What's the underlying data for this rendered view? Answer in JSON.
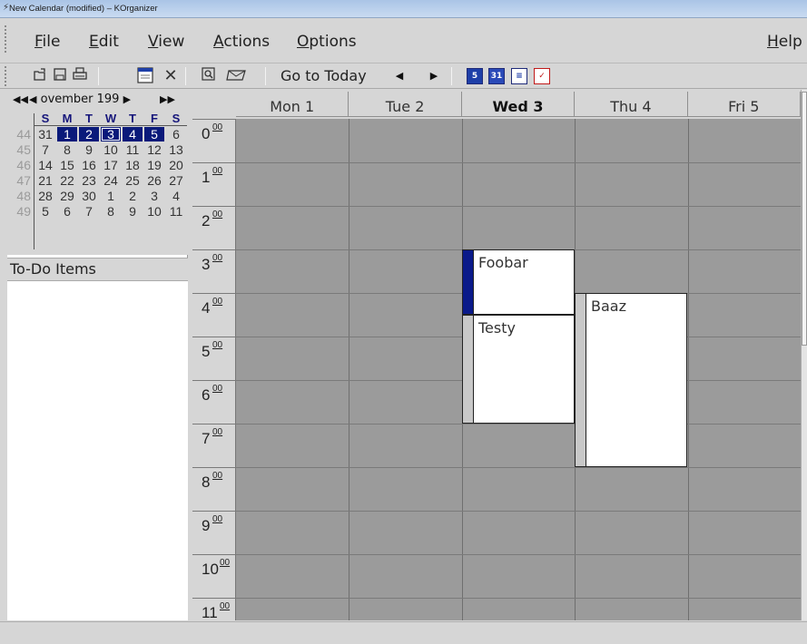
{
  "window": {
    "title": "New Calendar (modified) – KOrganizer"
  },
  "menubar": {
    "items": [
      {
        "mnemonic": "F",
        "rest": "ile"
      },
      {
        "mnemonic": "E",
        "rest": "dit"
      },
      {
        "mnemonic": "V",
        "rest": "iew"
      },
      {
        "mnemonic": "A",
        "rest": "ctions"
      },
      {
        "mnemonic": "O",
        "rest": "ptions"
      },
      {
        "mnemonic": "H",
        "rest": "elp"
      }
    ]
  },
  "toolbar": {
    "icons": [
      "open-icon",
      "save-icon",
      "print-icon",
      "new-event-icon",
      "delete-icon",
      "find-icon",
      "mail-icon"
    ],
    "go_to_today": "Go to Today",
    "prev_glyph": "◀",
    "next_glyph": "▶",
    "view_buttons": [
      {
        "icon": "work-week-view-icon",
        "label": "5"
      },
      {
        "icon": "month-view-icon",
        "label": "31"
      },
      {
        "icon": "list-view-icon",
        "label": "≡"
      },
      {
        "icon": "todo-view-icon",
        "label": "✓"
      }
    ]
  },
  "mini_calendar": {
    "month_label": "ovember 199",
    "prev_year": "◀◀",
    "prev_month": "◀",
    "next_month": "▶",
    "next_year": "▶▶",
    "weekday_headers": [
      "S",
      "M",
      "T",
      "W",
      "T",
      "F",
      "S"
    ],
    "weeks": [
      {
        "week": "44",
        "days": [
          "31",
          "1",
          "2",
          "3",
          "4",
          "5",
          "6"
        ]
      },
      {
        "week": "45",
        "days": [
          "7",
          "8",
          "9",
          "10",
          "11",
          "12",
          "13"
        ]
      },
      {
        "week": "46",
        "days": [
          "14",
          "15",
          "16",
          "17",
          "18",
          "19",
          "20"
        ]
      },
      {
        "week": "47",
        "days": [
          "21",
          "22",
          "23",
          "24",
          "25",
          "26",
          "27"
        ]
      },
      {
        "week": "48",
        "days": [
          "28",
          "29",
          "30",
          "1",
          "2",
          "3",
          "4"
        ]
      },
      {
        "week": "49",
        "days": [
          "5",
          "6",
          "7",
          "8",
          "9",
          "10",
          "11"
        ]
      }
    ],
    "selected_days": [
      "1",
      "2",
      "4",
      "5"
    ],
    "today": "3"
  },
  "todo": {
    "header": "To-Do Items"
  },
  "agenda": {
    "days": [
      {
        "label": "Mon 1",
        "today": false
      },
      {
        "label": "Tue 2",
        "today": false
      },
      {
        "label": "Wed 3",
        "today": true
      },
      {
        "label": "Thu 4",
        "today": false
      },
      {
        "label": "Fri 5",
        "today": false
      }
    ],
    "hours": [
      "0",
      "1",
      "2",
      "3",
      "4",
      "5",
      "6",
      "7",
      "8",
      "9",
      "10",
      "11"
    ],
    "minutes_label": "00",
    "events": [
      {
        "title": "Foobar",
        "day": 2,
        "start": 3.0,
        "end": 4.5,
        "bar_color": "#0a1a8a"
      },
      {
        "title": "Testy",
        "day": 2,
        "start": 4.5,
        "end": 7.0,
        "bar_color": "#c8c8c8"
      },
      {
        "title": "Baaz",
        "day": 3,
        "start": 4.0,
        "end": 8.0,
        "bar_color": "#c8c8c8"
      }
    ]
  }
}
